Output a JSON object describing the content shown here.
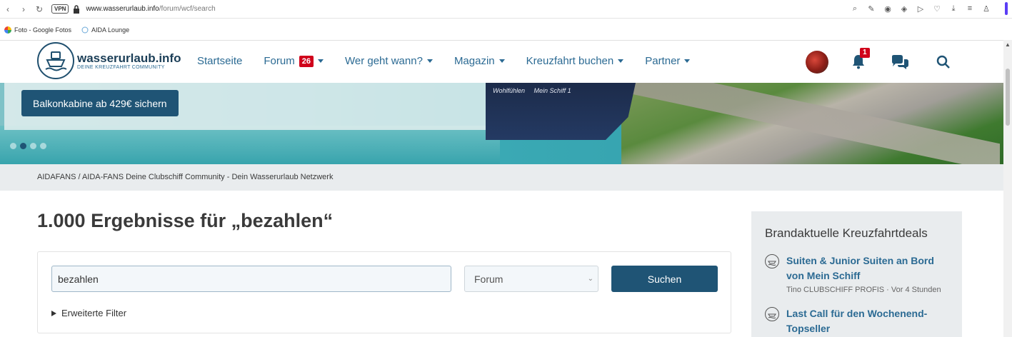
{
  "browser": {
    "url_domain": "www.wasserurlaub.info",
    "url_path": "/forum/wcf/search",
    "vpn_label": "VPN",
    "bookmarks": [
      {
        "label": "Foto - Google Fotos"
      },
      {
        "label": "AIDA Lounge"
      }
    ]
  },
  "header": {
    "logo_name": "wasserurlaub.info",
    "logo_tagline": "DEINE KREUZFAHRT COMMUNITY",
    "nav": [
      {
        "label": "Startseite"
      },
      {
        "label": "Forum",
        "badge": "26"
      },
      {
        "label": "Wer geht wann?"
      },
      {
        "label": "Magazin"
      },
      {
        "label": "Kreuzfahrt buchen"
      },
      {
        "label": "Partner"
      }
    ],
    "notification_count": "1"
  },
  "hero": {
    "cta_label": "Balkonkabine ab 429€ sichern",
    "ship_text": "Mein Schiff 1",
    "ship_slogan": "Wohlfühlen",
    "slide_count": 4,
    "active_slide": 2
  },
  "breadcrumb": {
    "text": "AIDAFANS / AIDA-FANS Deine Clubschiff Community - Dein Wasserurlaub Netzwerk"
  },
  "main": {
    "title": "1.000 Ergebnisse für „bezahlen“",
    "search_value": "bezahlen",
    "select_value": "Forum",
    "search_button": "Suchen",
    "filters_label": "Erweiterte Filter"
  },
  "sidebar": {
    "title": "Brandaktuelle Kreuzfahrtdeals",
    "deals": [
      {
        "title": "Suiten & Junior Suiten an Bord von Mein Schiff",
        "meta": "Tino CLUBSCHIFF PROFIS · Vor 4 Stunden"
      },
      {
        "title": "Last Call für den Wochenend-Topseller",
        "meta": ""
      }
    ]
  },
  "colors": {
    "brand_dark": "#1f5475",
    "link": "#2b6a93",
    "badge_red": "#d0021b",
    "breadcrumb_bg": "#e9ecee"
  }
}
